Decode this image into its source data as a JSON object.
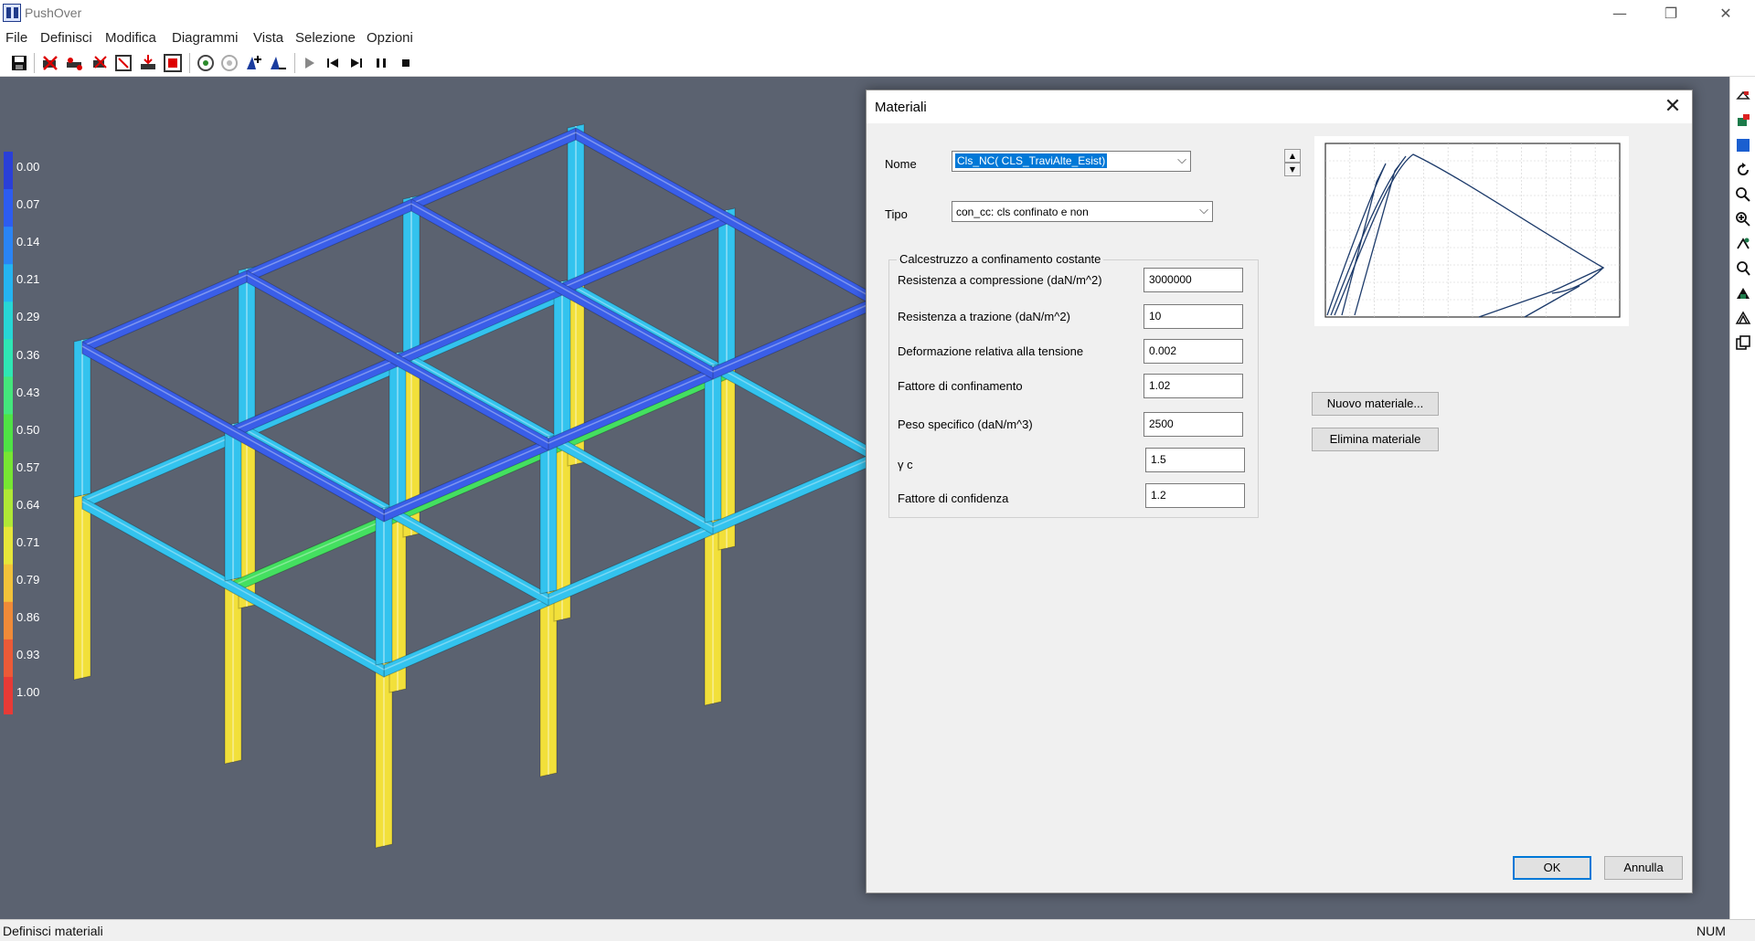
{
  "app": {
    "title": "PushOver"
  },
  "menu": [
    "File",
    "Definisci",
    "Modifica",
    "Diagrammi",
    "Vista",
    "Selezione",
    "Opzioni"
  ],
  "legend": {
    "values": [
      "0.00",
      "0.07",
      "0.14",
      "0.21",
      "0.29",
      "0.36",
      "0.43",
      "0.50",
      "0.57",
      "0.64",
      "0.71",
      "0.79",
      "0.86",
      "0.93",
      "1.00"
    ],
    "colors": [
      "#2a3fd8",
      "#2d5cf0",
      "#2a84f5",
      "#24b4f2",
      "#27d6d6",
      "#2fe6b4",
      "#44e67c",
      "#4fe345",
      "#77e632",
      "#b0e836",
      "#e6e63a",
      "#f2c23a",
      "#f08a38",
      "#ec5a37",
      "#e83a36"
    ]
  },
  "status": {
    "text": "Definisci materiali",
    "num": "NUM"
  },
  "dialog": {
    "title": "Materiali",
    "nome_label": "Nome",
    "nome_value": "Cls_NC( CLS_TraviAlte_Esist)",
    "tipo_label": "Tipo",
    "tipo_value": "con_cc: cls confinato e non",
    "group_title": "Calcestruzzo a confinamento costante",
    "fields": [
      {
        "label": "Resistenza a compressione (daN/m^2)",
        "value": "3000000"
      },
      {
        "label": "Resistenza a trazione (daN/m^2)",
        "value": "10"
      },
      {
        "label": "Deformazione relativa alla tensione",
        "value": "0.002"
      },
      {
        "label": "Fattore di confinamento",
        "value": "1.02"
      },
      {
        "label": "Peso specifico (daN/m^3)",
        "value": "2500"
      },
      {
        "label": "γ c",
        "value": "1.5"
      },
      {
        "label": "Fattore di confidenza",
        "value": "1.2"
      }
    ],
    "nuovo_label": "Nuovo materiale...",
    "elimina_label": "Elimina materiale",
    "ok_label": "OK",
    "annulla_label": "Annulla"
  },
  "colors": {
    "viewport": "#5b6270",
    "beam_blue": "#3a5ee8",
    "column_cyan": "#33c3ee",
    "column_yellow": "#f2e03a",
    "beam_green": "#44e060",
    "accent": "#0078d7"
  }
}
